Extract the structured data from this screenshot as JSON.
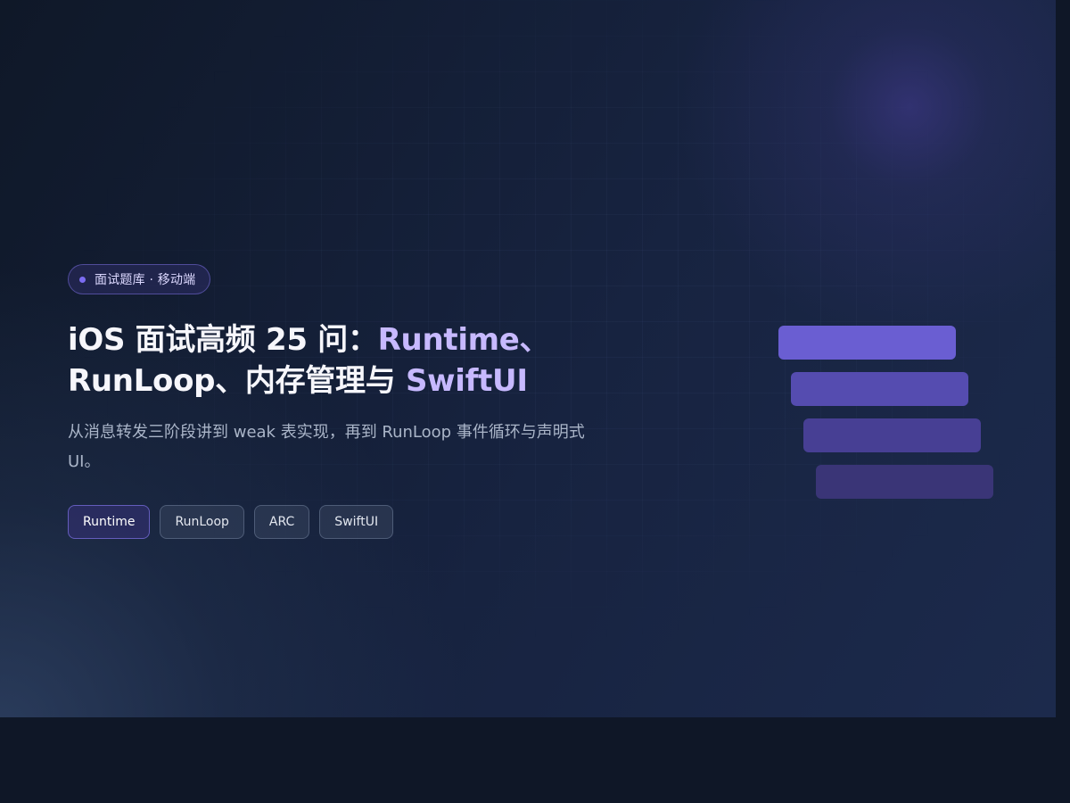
{
  "hero": {
    "eyebrow": "面试题库 · 移动端",
    "title_part1": "iOS 面试高频 25 问：",
    "title_accent1": "Runtime、",
    "title_part2": "RunLoop、内存管理与 ",
    "title_accent2": "SwiftUI",
    "subtitle": "从消息转发三阶段讲到 weak 表实现，再到 RunLoop 事件循环与声明式 UI。",
    "tags": [
      {
        "label": "Runtime",
        "active": true
      },
      {
        "label": "RunLoop",
        "active": false
      },
      {
        "label": "ARC",
        "active": false
      },
      {
        "label": "SwiftUI",
        "active": false
      }
    ]
  },
  "colors": {
    "accent": "#7c6cf2",
    "accent_text": "#c7b9ff",
    "background": "#0f1727"
  }
}
